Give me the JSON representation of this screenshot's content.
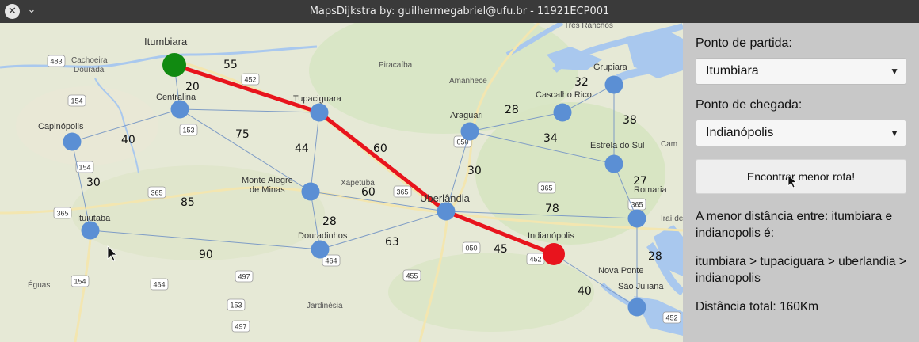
{
  "window": {
    "title": "MapsDijkstra by: guilhermegabriel@ufu.br - 11921ECP001",
    "close_icon": "close-icon",
    "menu_icon": "chevron-down-icon"
  },
  "panel": {
    "start_label": "Ponto de partida:",
    "start_value": "Itumbiara",
    "end_label": "Ponto de chegada:",
    "end_value": "Indianópolis",
    "button_label": "Encontrar menor rota!",
    "result_intro": "A menor distância entre: itumbiara e indianopolis é:",
    "result_route": "itumbiara > tupaciguara > uberlandia > indianopolis",
    "result_total": "Distância total: 160Km"
  },
  "colors": {
    "route": "#e8141d",
    "node": "#5b8fd4",
    "start_node": "#118a11",
    "end_node": "#e8141d",
    "edge": "#7e9cc6"
  },
  "map": {
    "cities": [
      {
        "id": "itumbiara",
        "name": "Itumbiara"
      },
      {
        "id": "centralina",
        "name": "Centralina"
      },
      {
        "id": "capinopolis",
        "name": "Capinópolis"
      },
      {
        "id": "tupaciguara",
        "name": "Tupaciguara"
      },
      {
        "id": "araguari",
        "name": "Araguari"
      },
      {
        "id": "cascalho_rico",
        "name": "Cascalho Rico"
      },
      {
        "id": "grupiara",
        "name": "Grupiara"
      },
      {
        "id": "estrela_do_sul",
        "name": "Estrela do Sul"
      },
      {
        "id": "monte_alegre",
        "name": "Monte Alegre de Minas"
      },
      {
        "id": "uberlandia",
        "name": "Uberlândia"
      },
      {
        "id": "ituiutaba",
        "name": "Ituiutaba"
      },
      {
        "id": "douradinhos",
        "name": "Douradinhos"
      },
      {
        "id": "indianopolis",
        "name": "Indianópolis"
      },
      {
        "id": "romaria",
        "name": "Romaria"
      },
      {
        "id": "nova_ponte",
        "name": "Nova Ponte"
      },
      {
        "id": "sao_juliana",
        "name": "São Juliana"
      }
    ],
    "edges": [
      {
        "from": "itumbiara",
        "to": "tupaciguara",
        "km": "55"
      },
      {
        "from": "itumbiara",
        "to": "centralina",
        "km": "20"
      },
      {
        "from": "centralina",
        "to": "capinopolis",
        "km": "40"
      },
      {
        "from": "centralina",
        "to": "tupaciguara",
        "km": "75"
      },
      {
        "from": "capinopolis",
        "to": "ituiutaba",
        "km": "30"
      },
      {
        "from": "centralina",
        "to": "monte_alegre",
        "km": "85"
      },
      {
        "from": "tupaciguara",
        "to": "monte_alegre",
        "km": "44"
      },
      {
        "from": "tupaciguara",
        "to": "uberlandia",
        "km": "60"
      },
      {
        "from": "monte_alegre",
        "to": "uberlandia",
        "km": "60"
      },
      {
        "from": "monte_alegre",
        "to": "douradinhos",
        "km": "28"
      },
      {
        "from": "ituiutaba",
        "to": "douradinhos",
        "km": "90"
      },
      {
        "from": "douradinhos",
        "to": "uberlandia",
        "km": "63"
      },
      {
        "from": "araguari",
        "to": "uberlandia",
        "km": "30"
      },
      {
        "from": "araguari",
        "to": "cascalho_rico",
        "km": "28"
      },
      {
        "from": "araguari",
        "to": "estrela_do_sul",
        "km": "34"
      },
      {
        "from": "cascalho_rico",
        "to": "grupiara",
        "km": "32"
      },
      {
        "from": "grupiara",
        "to": "estrela_do_sul",
        "km": "38"
      },
      {
        "from": "estrela_do_sul",
        "to": "romaria",
        "km": "27"
      },
      {
        "from": "uberlandia",
        "to": "romaria",
        "km": "78"
      },
      {
        "from": "uberlandia",
        "to": "indianopolis",
        "km": "45"
      },
      {
        "from": "romaria",
        "to": "sao_juliana",
        "km": "28"
      },
      {
        "from": "indianopolis",
        "to": "sao_juliana",
        "km": "40"
      }
    ],
    "route": [
      "itumbiara",
      "tupaciguara",
      "uberlandia",
      "indianopolis"
    ],
    "road_labels": [
      "483",
      "154",
      "153",
      "452",
      "154",
      "365",
      "365",
      "154",
      "464",
      "153",
      "464",
      "497",
      "497",
      "365",
      "455",
      "050",
      "452",
      "050",
      "365",
      "365",
      "452"
    ],
    "place_labels": [
      "Cachoeira Dourada",
      "Piracaíba",
      "Amanhece",
      "Xapetuba",
      "Éguas",
      "Jardinésia",
      "Três Ranchos",
      "Cam",
      "Iraí de",
      "Nova Ponte",
      "São Juliana",
      "Indianópolis"
    ]
  }
}
